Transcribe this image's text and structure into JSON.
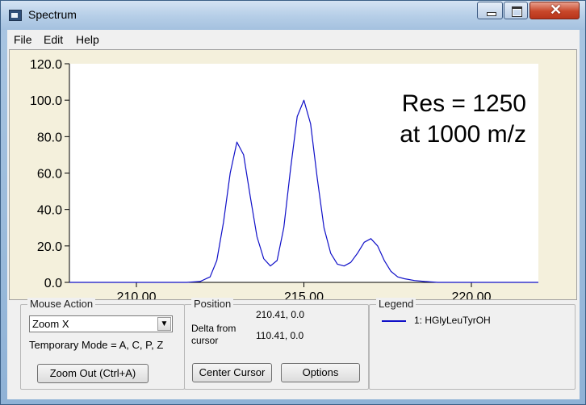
{
  "window": {
    "title": "Spectrum"
  },
  "menu": {
    "file": "File",
    "edit": "Edit",
    "help": "Help"
  },
  "chart_data": {
    "type": "line",
    "xlim": [
      208.0,
      222.0
    ],
    "ylim": [
      0,
      120
    ],
    "x_ticks": [
      "210.00",
      "215.00",
      "220.00"
    ],
    "y_ticks": [
      "0.0",
      "20.0",
      "40.0",
      "60.0",
      "80.0",
      "100.0",
      "120.0"
    ],
    "annotation": [
      "Res = 1250",
      "at 1000 m/z"
    ],
    "grid": false,
    "line_color": "#1010c8",
    "series": [
      {
        "name": "1: HGlyLeuTyrOH",
        "x": [
          208.0,
          211.5,
          211.9,
          212.2,
          212.4,
          212.6,
          212.8,
          213.0,
          213.2,
          213.4,
          213.6,
          213.8,
          214.0,
          214.2,
          214.4,
          214.6,
          214.8,
          215.0,
          215.2,
          215.4,
          215.6,
          215.8,
          216.0,
          216.2,
          216.4,
          216.6,
          216.8,
          217.0,
          217.2,
          217.4,
          217.6,
          217.8,
          218.0,
          218.3,
          218.6,
          219.0,
          222.0
        ],
        "y": [
          0,
          0,
          0.5,
          3,
          12,
          33,
          60,
          77,
          70,
          47,
          25,
          13,
          9,
          12,
          30,
          62,
          91,
          100,
          87,
          57,
          30,
          16,
          10,
          9,
          11,
          16,
          22,
          24,
          20,
          12,
          6,
          3,
          2,
          1,
          0.5,
          0,
          0
        ]
      }
    ]
  },
  "mouse_action": {
    "legend": "Mouse Action",
    "mode": "Zoom X",
    "temp_mode": "Temporary Mode = A, C, P, Z",
    "zoom_out": "Zoom Out (Ctrl+A)"
  },
  "position": {
    "legend": "Position",
    "value": "210.41, 0.0",
    "delta_label": "Delta from cursor",
    "delta_value": "110.41, 0.0",
    "center_cursor": "Center Cursor",
    "options": "Options"
  },
  "legend": {
    "legend": "Legend",
    "entry": "1: HGlyLeuTyrOH"
  }
}
